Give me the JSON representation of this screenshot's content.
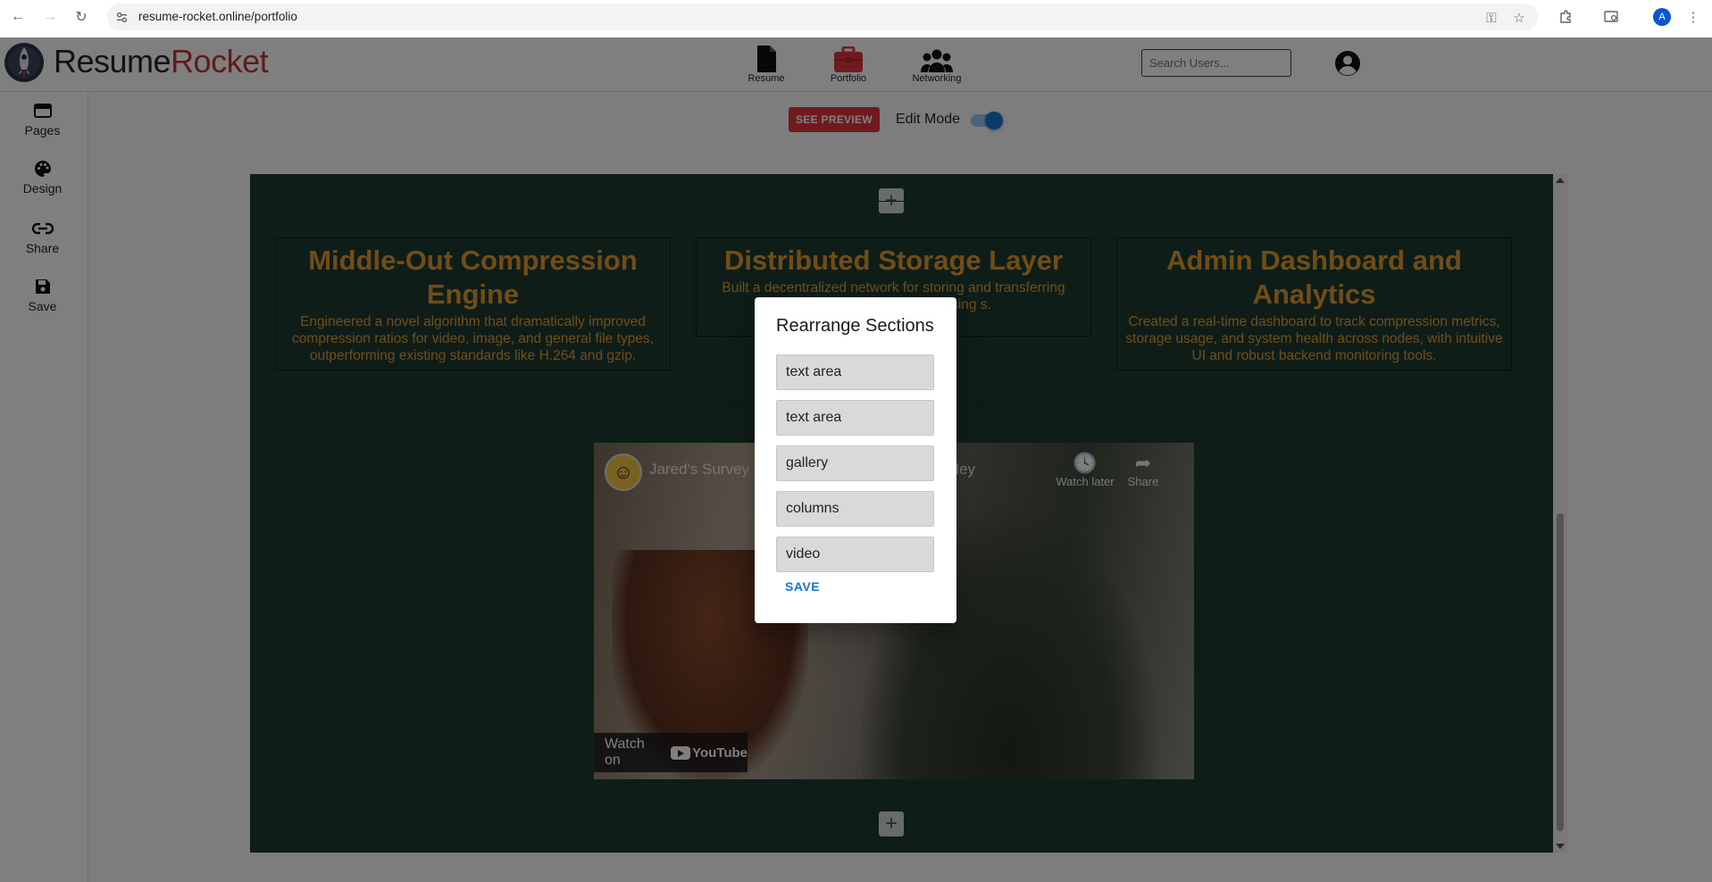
{
  "browser": {
    "url": "resume-rocket.online/portfolio",
    "profile_initial": "A"
  },
  "header": {
    "brand_part1": "Resume",
    "brand_part2": "Rocket",
    "nav": [
      {
        "label": "Resume",
        "icon": "file-icon"
      },
      {
        "label": "Portfolio",
        "icon": "briefcase-icon",
        "accent": "#e0343f"
      },
      {
        "label": "Networking",
        "icon": "people-icon"
      }
    ],
    "search_placeholder": "Search Users..."
  },
  "sidebar": {
    "items": [
      {
        "label": "Pages",
        "icon": "web-page-icon"
      },
      {
        "label": "Design",
        "icon": "palette-icon"
      },
      {
        "label": "Share",
        "icon": "link-icon"
      },
      {
        "label": "Save",
        "icon": "floppy-disk-icon"
      }
    ]
  },
  "toolbar": {
    "preview_label": "SEE PREVIEW",
    "edit_mode_label": "Edit Mode",
    "edit_mode_on": true
  },
  "projects": [
    {
      "title": "Middle-Out Compression Engine",
      "description": "Engineered a novel algorithm that dramatically improved compression ratios for video, image, and general file types, outperforming existing standards like H.264 and gzip."
    },
    {
      "title": "Distributed Storage Layer",
      "description": "Built a decentralized network for storing and transferring compres fault tolerance using s."
    },
    {
      "title": "Admin Dashboard and Analytics",
      "description": "Created a real-time dashboard to track compression metrics, storage usage, and system health across nodes, with intuitive UI and robust backend monitoring tools."
    }
  ],
  "video": {
    "title_visible": "Jared's Survey",
    "title_tail": "alley",
    "watch_later": "Watch later",
    "share": "Share",
    "watch_on": "Watch on",
    "youtube": "YouTube"
  },
  "dialog": {
    "title": "Rearrange Sections",
    "sections": [
      "text area",
      "text area",
      "gallery",
      "columns",
      "video"
    ],
    "save_label": "SAVE"
  },
  "colors": {
    "canvas_bg": "#1f3a33",
    "project_text": "#e09a2e",
    "brand_accent": "#c1363b",
    "preview_button": "#e0343f"
  }
}
